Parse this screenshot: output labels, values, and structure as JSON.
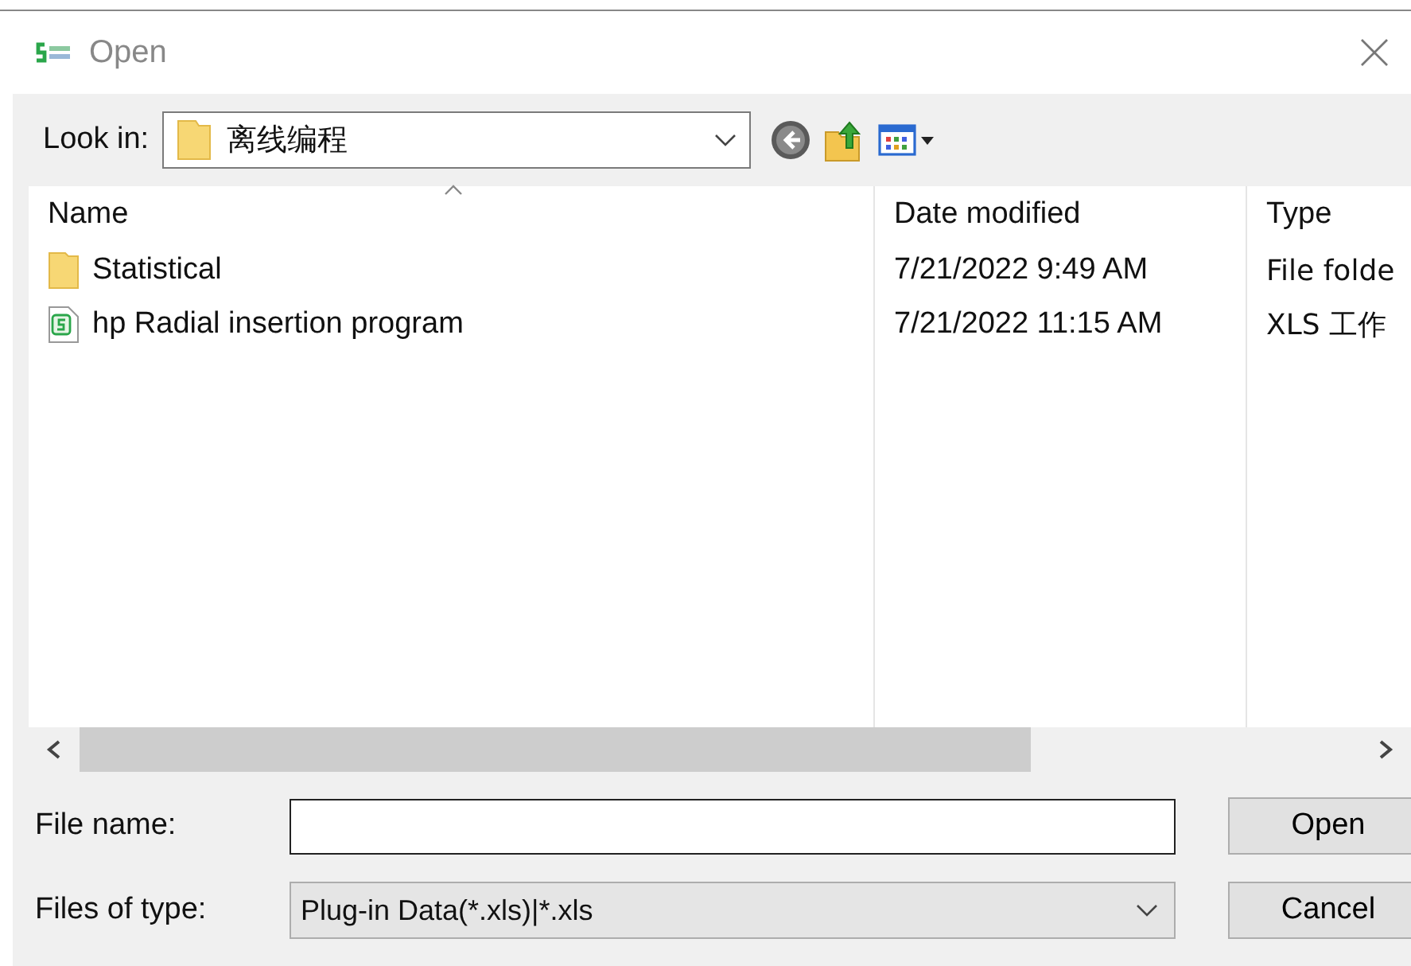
{
  "window": {
    "title": "Open"
  },
  "look_in": {
    "label": "Look in:",
    "location": "离线编程"
  },
  "file_list": {
    "columns": [
      "Name",
      "Date modified",
      "Type"
    ],
    "rows": [
      {
        "kind": "folder",
        "name": "Statistical",
        "date": "7/21/2022 9:49 AM",
        "type": "File folde"
      },
      {
        "kind": "sheet",
        "name": "hp Radial insertion program",
        "date": "7/21/2022 11:15 AM",
        "type": "XLS 工作"
      }
    ]
  },
  "file_name": {
    "label": "File name:"
  },
  "file_type": {
    "label": "Files of type:",
    "value": "Plug-in Data(*.xls)|*.xls"
  },
  "buttons": [
    "Open",
    "Cancel"
  ]
}
